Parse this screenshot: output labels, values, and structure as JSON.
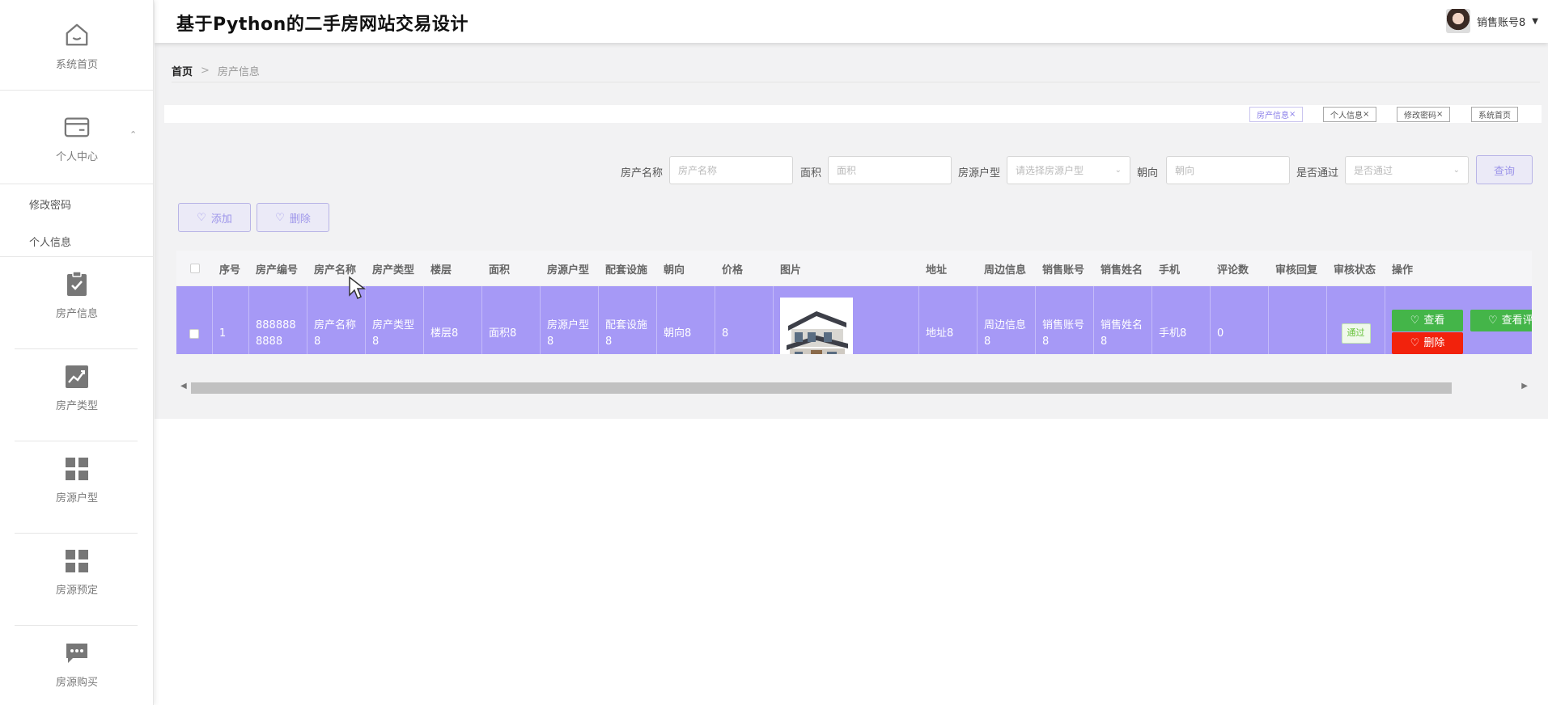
{
  "app": {
    "title": "基于Python的二手房网站交易设计"
  },
  "user": {
    "name": "销售账号8"
  },
  "sidebar": {
    "home": "系统首页",
    "personal": "个人中心",
    "sub_items": [
      "修改密码",
      "个人信息"
    ],
    "items": [
      "房产信息",
      "房产类型",
      "房源户型",
      "房源预定",
      "房源购买"
    ]
  },
  "breadcrumb": {
    "home": "首页",
    "sep": ">",
    "current": "房产信息"
  },
  "tabs": [
    "房产信息",
    "个人信息",
    "修改密码",
    "系统首页"
  ],
  "tab_close": "×",
  "search": {
    "name_label": "房产名称",
    "name_placeholder": "房产名称",
    "area_label": "面积",
    "area_placeholder": "面积",
    "layout_label": "房源户型",
    "layout_placeholder": "请选择房源户型",
    "orient_label": "朝向",
    "orient_placeholder": "朝向",
    "pass_label": "是否通过",
    "pass_placeholder": "是否通过",
    "query_btn": "查询"
  },
  "actions": {
    "add": "添加",
    "delete": "删除"
  },
  "table": {
    "headers": [
      "序号",
      "房产编号",
      "房产名称",
      "房产类型",
      "楼层",
      "面积",
      "房源户型",
      "配套设施",
      "朝向",
      "价格",
      "图片",
      "地址",
      "周边信息",
      "销售账号",
      "销售姓名",
      "手机",
      "评论数",
      "审核回复",
      "审核状态",
      "操作"
    ],
    "row": {
      "index": "1",
      "code": "8888888888",
      "name": "房产名称8",
      "type": "房产类型8",
      "floor": "楼层8",
      "area": "面积8",
      "layout": "房源户型8",
      "facilities": "配套设施8",
      "orient": "朝向8",
      "price": "8",
      "address": "地址8",
      "nearby": "周边信息8",
      "sales_account": "销售账号8",
      "sales_name": "销售姓名8",
      "phone": "手机8",
      "comments": "0",
      "reply": "",
      "status": "通过",
      "view_btn": "查看",
      "view_comments_btn": "查看评",
      "delete_btn": "删除"
    }
  },
  "colors": {
    "accent": "#a699f6",
    "green": "#44b549",
    "red": "#f2220c"
  }
}
